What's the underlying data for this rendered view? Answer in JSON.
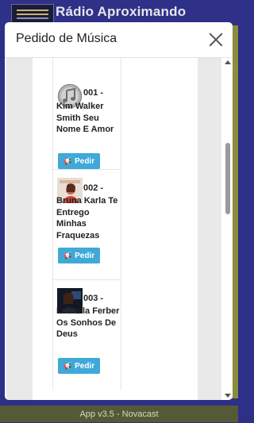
{
  "app": {
    "title": "Rádio Aproximando",
    "footer": "App v3.5 - Novacast",
    "colors": {
      "header": "#2f3087",
      "footer": "#555a36",
      "button": "#3fa9d8"
    }
  },
  "modal": {
    "title": "Pedido de Música",
    "close_icon": "close-icon",
    "songs": [
      {
        "number": "001 -",
        "title": "Kim Walker Smith Seu Nome E Amor",
        "button_label": "Pedir",
        "thumb": "music-note-icon"
      },
      {
        "number": "002 -",
        "title": "Bruna Karla Te Entrego Minhas Fraquezas",
        "button_label": "Pedir",
        "thumb": "album-cover"
      },
      {
        "number": "003 -",
        "title": "Ludmila Ferber Os Sonhos De Deus",
        "button_label": "Pedir",
        "thumb": "album-cover"
      }
    ]
  }
}
